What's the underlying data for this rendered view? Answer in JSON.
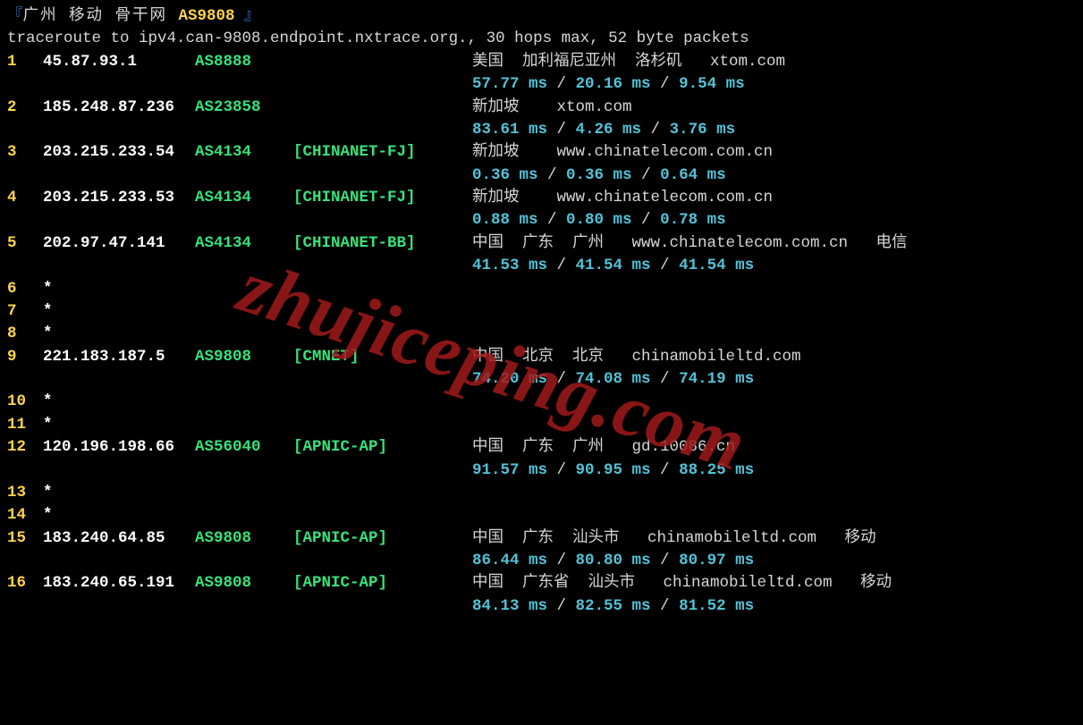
{
  "title": {
    "open_bracket": "『",
    "text_cn": "广州  移动  骨干网 ",
    "asn_hl": "AS9808",
    "close_bracket": " 』"
  },
  "intro": "traceroute to ipv4.can-9808.endpoint.nxtrace.org., 30 hops max, 52 byte packets",
  "watermark": "zhujiceping.com",
  "hops": [
    {
      "n": "1",
      "ip": "45.87.93.1",
      "asn": "AS8888",
      "net": "",
      "loc": "美国  加利福尼亚州  洛杉矶   xtom.com",
      "t1": "57.77 ms",
      "t2": "20.16 ms",
      "t3": "9.54 ms"
    },
    {
      "n": "2",
      "ip": "185.248.87.236",
      "asn": "AS23858",
      "net": "",
      "loc": "新加坡    xtom.com",
      "t1": "83.61 ms",
      "t2": "4.26 ms",
      "t3": "3.76 ms"
    },
    {
      "n": "3",
      "ip": "203.215.233.54",
      "asn": "AS4134",
      "net": "[CHINANET-FJ]",
      "loc": "新加坡    www.chinatelecom.com.cn",
      "t1": "0.36 ms",
      "t2": "0.36 ms",
      "t3": "0.64 ms"
    },
    {
      "n": "4",
      "ip": "203.215.233.53",
      "asn": "AS4134",
      "net": "[CHINANET-FJ]",
      "loc": "新加坡    www.chinatelecom.com.cn",
      "t1": "0.88 ms",
      "t2": "0.80 ms",
      "t3": "0.78 ms"
    },
    {
      "n": "5",
      "ip": "202.97.47.141",
      "asn": "AS4134",
      "net": "[CHINANET-BB]",
      "loc": "中国  广东  广州   www.chinatelecom.com.cn   电信",
      "t1": "41.53 ms",
      "t2": "41.54 ms",
      "t3": "41.54 ms"
    },
    {
      "n": "6",
      "star": "*"
    },
    {
      "n": "7",
      "star": "*"
    },
    {
      "n": "8",
      "star": "*"
    },
    {
      "n": "9",
      "ip": "221.183.187.5",
      "asn": "AS9808",
      "net": "[CMNET]",
      "loc": "中国  北京  北京   chinamobileltd.com",
      "t1": "74.20 ms",
      "t2": "74.08 ms",
      "t3": "74.19 ms"
    },
    {
      "n": "10",
      "star": "*"
    },
    {
      "n": "11",
      "star": "*"
    },
    {
      "n": "12",
      "ip": "120.196.198.66",
      "asn": "AS56040",
      "net": "[APNIC-AP]",
      "loc": "中国  广东  广州   gd.10086.cn",
      "t1": "91.57 ms",
      "t2": "90.95 ms",
      "t3": "88.25 ms"
    },
    {
      "n": "13",
      "star": "*"
    },
    {
      "n": "14",
      "star": "*"
    },
    {
      "n": "15",
      "ip": "183.240.64.85",
      "asn": "AS9808",
      "net": "[APNIC-AP]",
      "loc": "中国  广东  汕头市   chinamobileltd.com   移动",
      "t1": "86.44 ms",
      "t2": "80.80 ms",
      "t3": "80.97 ms"
    },
    {
      "n": "16",
      "ip": "183.240.65.191",
      "asn": "AS9808",
      "net": "[APNIC-AP]",
      "loc": "中国  广东省  汕头市   chinamobileltd.com   移动",
      "t1": "84.13 ms",
      "t2": "82.55 ms",
      "t3": "81.52 ms"
    }
  ]
}
